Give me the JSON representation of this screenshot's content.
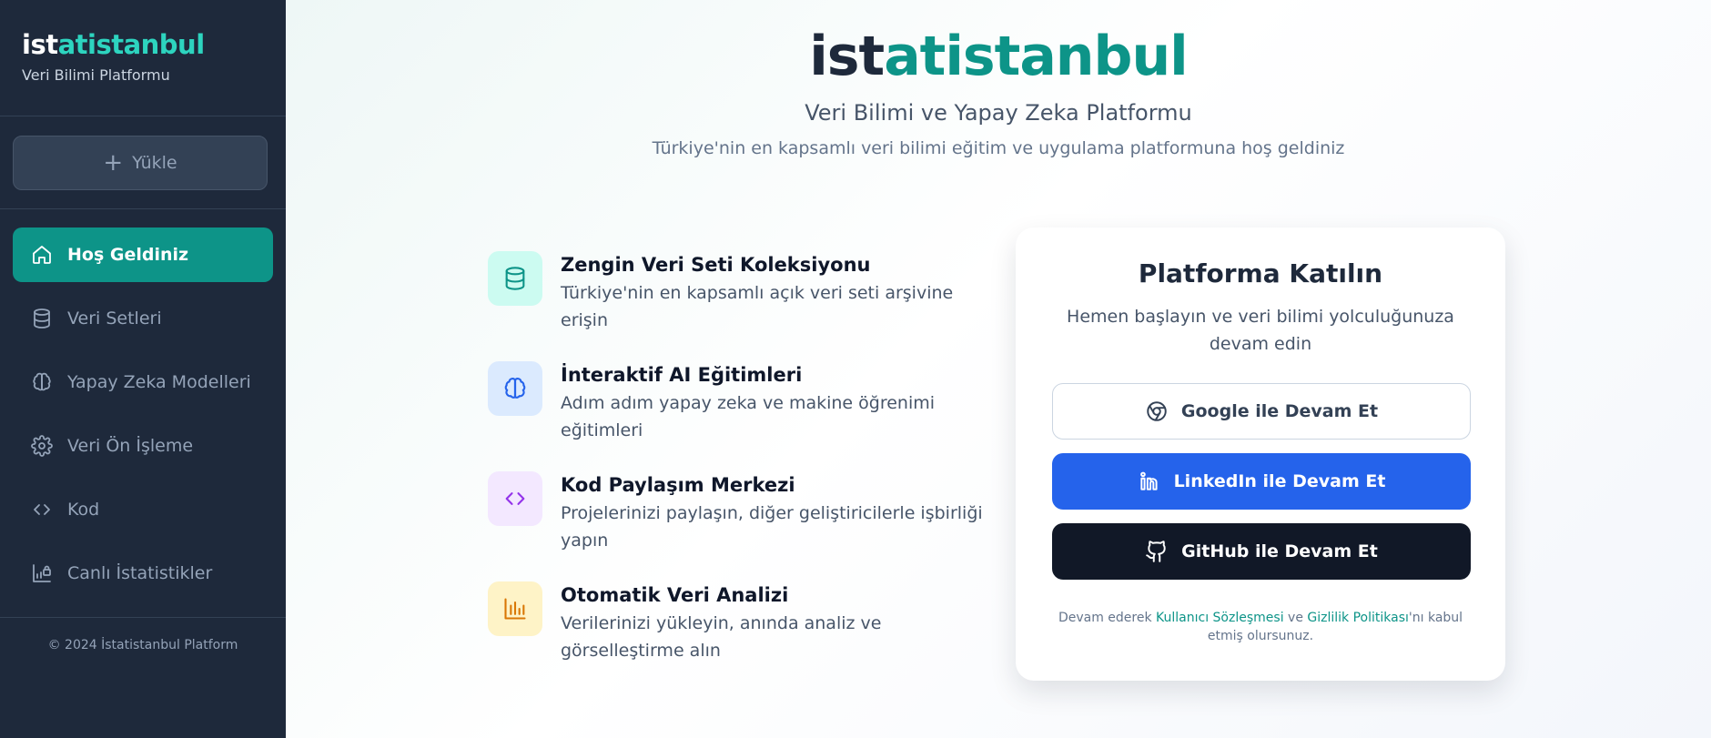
{
  "sidebar": {
    "brand_part1": "ist",
    "brand_part2": "atistanbul",
    "subtitle": "Veri Bilimi Platformu",
    "upload_label": "Yükle",
    "items": [
      {
        "label": "Hoş Geldiniz",
        "icon": "home-icon",
        "active": true
      },
      {
        "label": "Veri Setleri",
        "icon": "database-icon"
      },
      {
        "label": "Yapay Zeka Modelleri",
        "icon": "brain-icon"
      },
      {
        "label": "Veri Ön İşleme",
        "icon": "gear-icon"
      },
      {
        "label": "Kod",
        "icon": "code-icon"
      },
      {
        "label": "Canlı İstatistikler",
        "icon": "chart-lock-icon"
      }
    ],
    "copyright": "© 2024 İstatistanbul Platform"
  },
  "hero": {
    "logo_part1": "ist",
    "logo_part2": "atistanbul",
    "subtitle": "Veri Bilimi ve Yapay Zeka Platformu",
    "description": "Türkiye'nin en kapsamlı veri bilimi eğitim ve uygulama platformuna hoş geldiniz"
  },
  "features": [
    {
      "title": "Zengin Veri Seti Koleksiyonu",
      "desc": "Türkiye'nin en kapsamlı açık veri seti arşivine erişin",
      "icon": "database-icon"
    },
    {
      "title": "İnteraktif AI Eğitimleri",
      "desc": "Adım adım yapay zeka ve makine öğrenimi eğitimleri",
      "icon": "brain-icon"
    },
    {
      "title": "Kod Paylaşım Merkezi",
      "desc": "Projelerinizi paylaşın, diğer geliştiricilerle işbirliği yapın",
      "icon": "code-icon"
    },
    {
      "title": "Otomatik Veri Analizi",
      "desc": "Verilerinizi yükleyin, anında analiz ve görselleştirme alın",
      "icon": "bar-chart-icon"
    }
  ],
  "card": {
    "title": "Platforma Katılın",
    "description": "Hemen başlayın ve veri bilimi yolculuğunuza devam edin",
    "google_label": "Google ile Devam Et",
    "linkedin_label": "LinkedIn ile Devam Et",
    "github_label": "GitHub ile Devam Et",
    "legal_prefix": "Devam ederek ",
    "legal_terms": "Kullanıcı Sözleşmesi",
    "legal_and": " ve ",
    "legal_privacy": "Gizlilik Politikası",
    "legal_suffix": "'nı kabul etmiş olursunuz."
  },
  "colors": {
    "accent": "#0d9488",
    "sidebar_bg": "#1e293b",
    "linkedin": "#2563eb",
    "github": "#111827"
  }
}
